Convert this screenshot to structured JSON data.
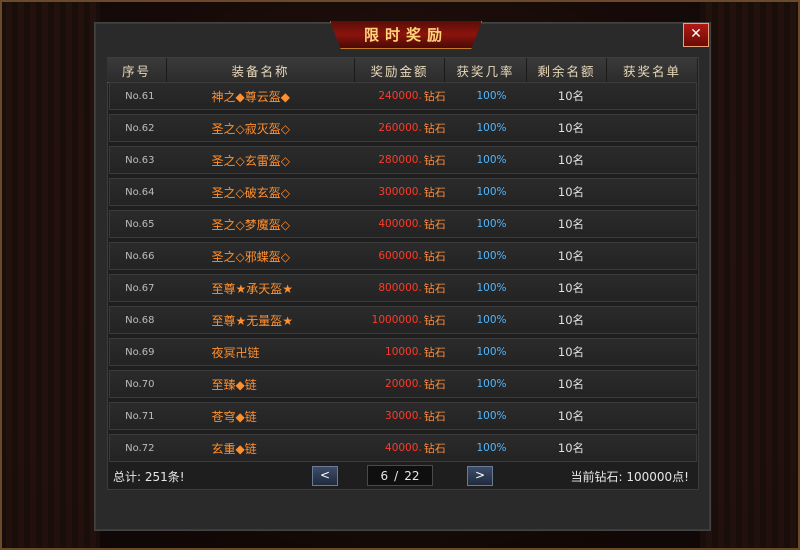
{
  "title": "限时奖励",
  "close_label": "✕",
  "columns": [
    "序号",
    "装备名称",
    "奖励金额",
    "获奖几率",
    "剩余名额",
    "获奖名单"
  ],
  "currency_unit": "钻石",
  "rows": [
    {
      "no": "No.61",
      "name": "神之◆尊云盔◆",
      "amount": "240000.",
      "rate": "100%",
      "remain": "10名"
    },
    {
      "no": "No.62",
      "name": "圣之◇寂灭盔◇",
      "amount": "260000.",
      "rate": "100%",
      "remain": "10名"
    },
    {
      "no": "No.63",
      "name": "圣之◇玄雷盔◇",
      "amount": "280000.",
      "rate": "100%",
      "remain": "10名"
    },
    {
      "no": "No.64",
      "name": "圣之◇破玄盔◇",
      "amount": "300000.",
      "rate": "100%",
      "remain": "10名"
    },
    {
      "no": "No.65",
      "name": "圣之◇梦魔盔◇",
      "amount": "400000.",
      "rate": "100%",
      "remain": "10名"
    },
    {
      "no": "No.66",
      "name": "圣之◇邪蝶盔◇",
      "amount": "600000.",
      "rate": "100%",
      "remain": "10名"
    },
    {
      "no": "No.67",
      "name": "至尊★承天盔★",
      "amount": "800000.",
      "rate": "100%",
      "remain": "10名"
    },
    {
      "no": "No.68",
      "name": "至尊★无量盔★",
      "amount": "1000000.",
      "rate": "100%",
      "remain": "10名"
    },
    {
      "no": "No.69",
      "name": "夜冥卍链",
      "amount": "10000.",
      "rate": "100%",
      "remain": "10名"
    },
    {
      "no": "No.70",
      "name": "至臻◆链",
      "amount": "20000.",
      "rate": "100%",
      "remain": "10名"
    },
    {
      "no": "No.71",
      "name": "苍穹◆链",
      "amount": "30000.",
      "rate": "100%",
      "remain": "10名"
    },
    {
      "no": "No.72",
      "name": "玄重◆链",
      "amount": "40000.",
      "rate": "100%",
      "remain": "10名"
    }
  ],
  "footer": {
    "total": "总计: 251条!",
    "page_current": "6",
    "page_sep": "/",
    "page_total": "22",
    "prev_label": "<",
    "next_label": ">",
    "diamonds": "当前钻石: 100000点!"
  },
  "colors": {
    "item_name": "#ff9030",
    "amount": "#ff3a2a",
    "rate": "#4fb8ff",
    "title": "#ffd47a"
  }
}
